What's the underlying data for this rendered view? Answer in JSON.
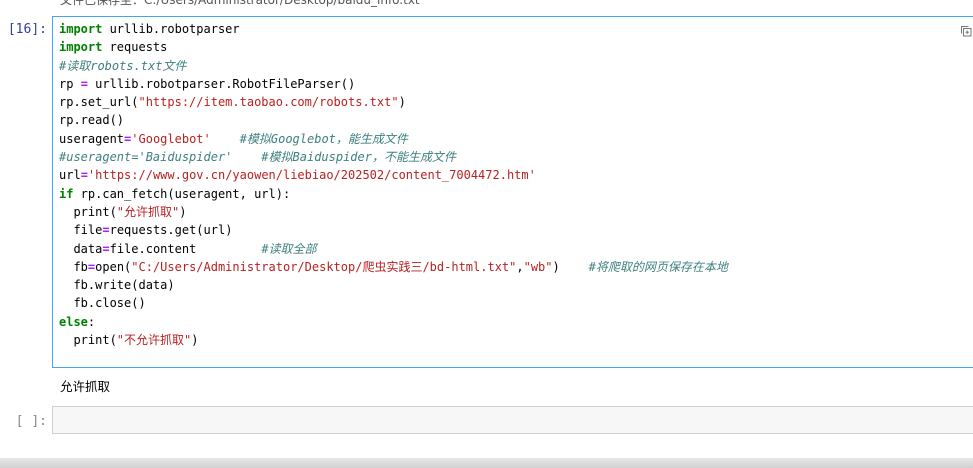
{
  "header": {
    "partial_text": "文件已保存至：C:/Users/Administrator/Desktop/baidu_info.txt"
  },
  "cell": {
    "prompt": "[16]:",
    "output": "允许抓取"
  },
  "empty_cell": {
    "prompt": "[ ]:"
  },
  "code": {
    "l1_kw": "import",
    "l1_rest": " urllib.robotparser",
    "l2_kw": "import",
    "l2_rest": " requests",
    "l3_cm": "#读取robots.txt文件",
    "l4_a": "rp ",
    "l4_op": "=",
    "l4_b": " urllib.robotparser.RobotFileParser()",
    "l5_a": "rp.set_url(",
    "l5_s": "\"https://item.taobao.com/robots.txt\"",
    "l5_b": ")",
    "l6": "rp.read()",
    "l7_a": "useragent",
    "l7_op": "=",
    "l7_s": "'Googlebot'",
    "l7_sp": "    ",
    "l7_cm": "#模拟Googlebot，能生成文件",
    "l8_cm": "#useragent='Baiduspider'    #模拟Baiduspider，不能生成文件",
    "l9_a": "url",
    "l9_op": "=",
    "l9_s": "'https://www.gov.cn/yaowen/liebiao/202502/content_7004472.htm'",
    "l10_kw": "if",
    "l10_rest": " rp.can_fetch(useragent, url):",
    "l11_a": "  print(",
    "l11_s": "\"允许抓取\"",
    "l11_b": ")",
    "l12_a": "  file",
    "l12_op": "=",
    "l12_b": "requests.get(url)",
    "l13_a": "  data",
    "l13_op": "=",
    "l13_b": "file.content",
    "l13_sp": "         ",
    "l13_cm": "#读取全部",
    "l14_a": "  fb",
    "l14_op": "=",
    "l14_b": "open(",
    "l14_s1": "\"C:/Users/Administrator/Desktop/爬虫实践三/bd-html.txt\"",
    "l14_c": ",",
    "l14_s2": "\"wb\"",
    "l14_d": ")",
    "l14_sp": "    ",
    "l14_cm": "#将爬取的网页保存在本地",
    "l15": "  fb.write(data)",
    "l16": "  fb.close()",
    "l17_kw": "else",
    "l17_b": ":",
    "l18_a": "  print(",
    "l18_s": "\"不允许抓取\"",
    "l18_b": ")"
  },
  "icons": {
    "copy": "copy-icon"
  }
}
